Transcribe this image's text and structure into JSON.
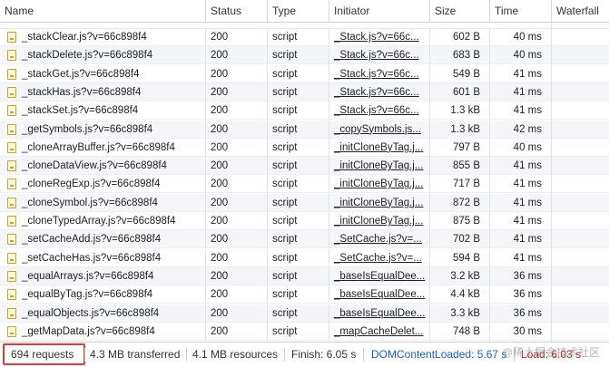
{
  "columns": [
    "Name",
    "Status",
    "Type",
    "Initiator",
    "Size",
    "Time",
    "Waterfall"
  ],
  "requests": [
    {
      "name": "_stackClear.js?v=66c898f4",
      "status": "200",
      "type": "script",
      "initiator": "_Stack.js?v=66c...",
      "size": "602 B",
      "time": "40 ms"
    },
    {
      "name": "_stackDelete.js?v=66c898f4",
      "status": "200",
      "type": "script",
      "initiator": "_Stack.js?v=66c...",
      "size": "683 B",
      "time": "40 ms"
    },
    {
      "name": "_stackGet.js?v=66c898f4",
      "status": "200",
      "type": "script",
      "initiator": "_Stack.js?v=66c...",
      "size": "549 B",
      "time": "41 ms"
    },
    {
      "name": "_stackHas.js?v=66c898f4",
      "status": "200",
      "type": "script",
      "initiator": "_Stack.js?v=66c...",
      "size": "601 B",
      "time": "41 ms"
    },
    {
      "name": "_stackSet.js?v=66c898f4",
      "status": "200",
      "type": "script",
      "initiator": "_Stack.js?v=66c...",
      "size": "1.3 kB",
      "time": "41 ms"
    },
    {
      "name": "_getSymbols.js?v=66c898f4",
      "status": "200",
      "type": "script",
      "initiator": "_copySymbols.js...",
      "size": "1.3 kB",
      "time": "42 ms"
    },
    {
      "name": "_cloneArrayBuffer.js?v=66c898f4",
      "status": "200",
      "type": "script",
      "initiator": "_initCloneByTag.j...",
      "size": "797 B",
      "time": "40 ms"
    },
    {
      "name": "_cloneDataView.js?v=66c898f4",
      "status": "200",
      "type": "script",
      "initiator": "_initCloneByTag.j...",
      "size": "855 B",
      "time": "41 ms"
    },
    {
      "name": "_cloneRegExp.js?v=66c898f4",
      "status": "200",
      "type": "script",
      "initiator": "_initCloneByTag.j...",
      "size": "717 B",
      "time": "41 ms"
    },
    {
      "name": "_cloneSymbol.js?v=66c898f4",
      "status": "200",
      "type": "script",
      "initiator": "_initCloneByTag.j...",
      "size": "872 B",
      "time": "41 ms"
    },
    {
      "name": "_cloneTypedArray.js?v=66c898f4",
      "status": "200",
      "type": "script",
      "initiator": "_initCloneByTag.j...",
      "size": "875 B",
      "time": "41 ms"
    },
    {
      "name": "_setCacheAdd.js?v=66c898f4",
      "status": "200",
      "type": "script",
      "initiator": "_SetCache.js?v=...",
      "size": "702 B",
      "time": "41 ms"
    },
    {
      "name": "_setCacheHas.js?v=66c898f4",
      "status": "200",
      "type": "script",
      "initiator": "_SetCache.js?v=...",
      "size": "594 B",
      "time": "41 ms"
    },
    {
      "name": "_equalArrays.js?v=66c898f4",
      "status": "200",
      "type": "script",
      "initiator": "_baseIsEqualDee...",
      "size": "3.2 kB",
      "time": "36 ms"
    },
    {
      "name": "_equalByTag.js?v=66c898f4",
      "status": "200",
      "type": "script",
      "initiator": "_baseIsEqualDee...",
      "size": "4.4 kB",
      "time": "36 ms"
    },
    {
      "name": "_equalObjects.js?v=66c898f4",
      "status": "200",
      "type": "script",
      "initiator": "_baseIsEqualDee...",
      "size": "3.3 kB",
      "time": "36 ms"
    },
    {
      "name": "_getMapData.js?v=66c898f4",
      "status": "200",
      "type": "script",
      "initiator": "_mapCacheDelet...",
      "size": "748 B",
      "time": "30 ms"
    }
  ],
  "status_bar": {
    "requests": "694 requests",
    "transferred": "4.3 MB transferred",
    "resources": "4.1 MB resources",
    "finish": "Finish: 6.05 s",
    "dom_content_loaded": "DOMContentLoaded: 5.67 s",
    "load": "Load: 6.03 s"
  },
  "watermark": "@稀土掘金技术社区",
  "colors": {
    "dcl": "#1a5fd6",
    "load": "#c5221f",
    "highlight": "#e53935",
    "alt_row": "#f4f6fa"
  }
}
